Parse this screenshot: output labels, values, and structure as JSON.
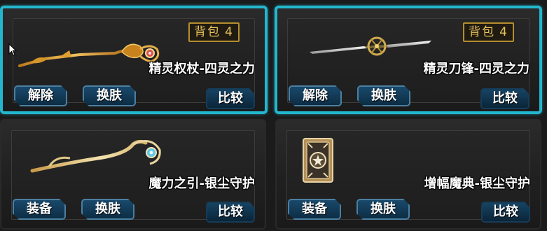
{
  "cards": [
    {
      "state": "selected",
      "badge": {
        "text": "背包",
        "number": "4"
      },
      "item_name": "精灵权杖-四灵之力",
      "primary_button": "解除",
      "skin_button": "换肤",
      "compare_button": "比较"
    },
    {
      "state": "selected",
      "badge": {
        "text": "背包",
        "number": "4"
      },
      "item_name": "精灵刀锋-四灵之力",
      "primary_button": "解除",
      "skin_button": "换肤",
      "compare_button": "比较"
    },
    {
      "state": "normal",
      "item_name": "魔力之引-银尘守护",
      "primary_button": "装备",
      "skin_button": "换肤",
      "compare_button": "比较"
    },
    {
      "state": "normal",
      "item_name": "增幅魔典-银尘守护",
      "primary_button": "装备",
      "skin_button": "换肤",
      "compare_button": "比较"
    }
  ],
  "colors": {
    "selected_border": "#23b7cf",
    "badge_gold": "#e8c25a",
    "button_blue": "#19496b"
  },
  "icons": [
    "scepter-icon",
    "blade-icon",
    "staff-icon",
    "tome-icon",
    "mouse-cursor-icon"
  ]
}
